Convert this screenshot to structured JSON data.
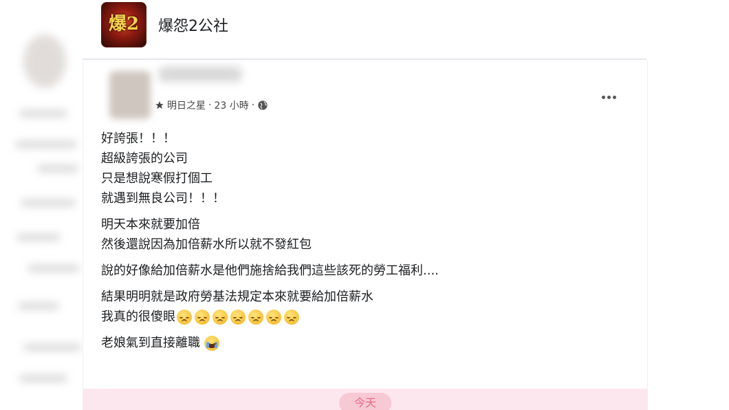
{
  "group": {
    "name": "爆怨2公社",
    "logo_text": "爆2"
  },
  "post": {
    "meta": {
      "badge_icon": "star-icon",
      "badge_label": "明日之星",
      "separator": "·",
      "time": "23 小時",
      "privacy_icon": "globe-icon"
    },
    "more_icon": "more-icon",
    "paragraphs": [
      [
        "好誇張！！！",
        "超級誇張的公司",
        "只是想說寒假打個工",
        "就遇到無良公司！！！"
      ],
      [
        "明天本來就要加倍",
        "然後還說因為加倍薪水所以就不發紅包"
      ],
      [
        "說的好像給加倍薪水是他們施捨給我們這些該死的勞工福利...."
      ],
      [
        "結果明明就是政府勞基法規定本來就要給加倍薪水",
        "我真的很傻眼"
      ],
      [
        "老娘氣到直接離職"
      ]
    ],
    "emojis": {
      "line_eyeroll_count": 7,
      "eyeroll_icon": "eye-roll-emoji-icon",
      "crying_icon": "crying-emoji-icon"
    },
    "footer_button": "今天"
  },
  "colors": {
    "text": "#1c1e21",
    "meta": "#444444",
    "footer_bg": "#fde7ee",
    "footer_pill": "#f7c9d4",
    "footer_text": "#e46a86"
  }
}
